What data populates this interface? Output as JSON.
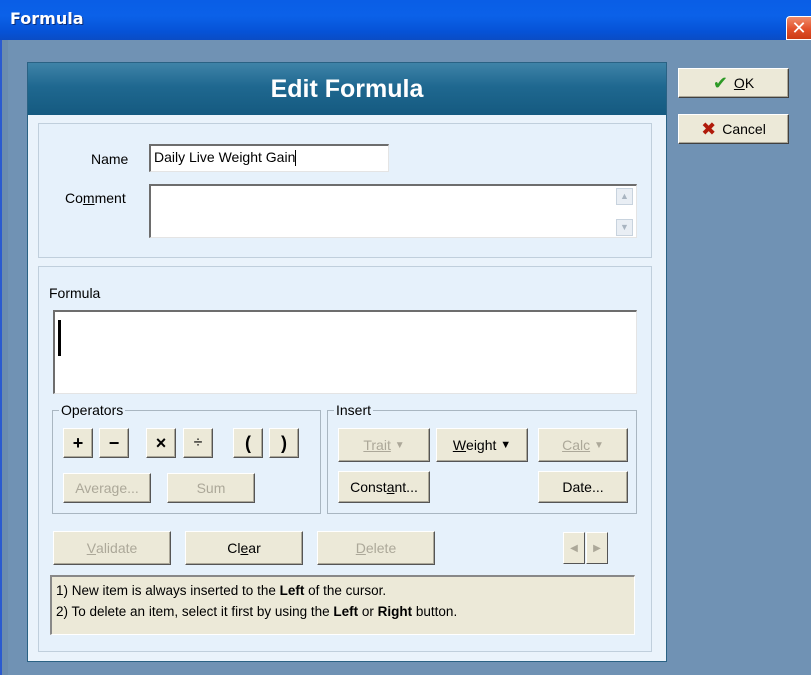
{
  "window": {
    "title": "Formula",
    "close_glyph": "✕"
  },
  "header": {
    "title": "Edit Formula"
  },
  "side_buttons": {
    "ok_label_prefix": "",
    "ok_label_u": "O",
    "ok_label_rest": "K",
    "cancel_label": "Cancel"
  },
  "fields": {
    "name_label": "Name",
    "name_value": "Daily Live Weight Gain",
    "comment_label_pre": "Co",
    "comment_label_u": "m",
    "comment_label_post": "ment",
    "comment_value": "",
    "formula_label": "Formula",
    "formula_value": ""
  },
  "operators": {
    "title": "Operators",
    "buttons": [
      "+",
      "−",
      "×",
      "÷",
      "(",
      ")"
    ],
    "average_label": "Average...",
    "sum_label": "Sum"
  },
  "insert": {
    "title": "Insert",
    "trait_label": "Trait",
    "weight_u": "W",
    "weight_rest": "eight",
    "calc_label": "Calc",
    "constant_pre": "Const",
    "constant_u": "a",
    "constant_post": "nt...",
    "date_label": "Date..."
  },
  "actions": {
    "validate_u": "V",
    "validate_rest": "alidate",
    "clear_pre": "Cl",
    "clear_u": "e",
    "clear_post": "ar",
    "delete_u": "D",
    "delete_rest": "elete"
  },
  "hint": {
    "line1_pre": "1) New item is always inserted to the ",
    "line1_bold": "Left",
    "line1_post": " of the cursor.",
    "line2_pre": "2) To delete an item, select it first by using the ",
    "line2_bold1": "Left",
    "line2_mid": " or ",
    "line2_bold2": "Right",
    "line2_post": " button."
  },
  "colors": {
    "titlebar": "#0a5ee6",
    "header": "#1f6890",
    "background": "#7092b4",
    "ok_check": "#2d9a26",
    "cancel_x": "#b01a0a"
  },
  "icons": [
    "check-icon",
    "cancel-x-icon",
    "dropdown-arrow-icon",
    "scroll-up-icon",
    "scroll-down-icon",
    "nav-left-icon",
    "nav-right-icon"
  ]
}
